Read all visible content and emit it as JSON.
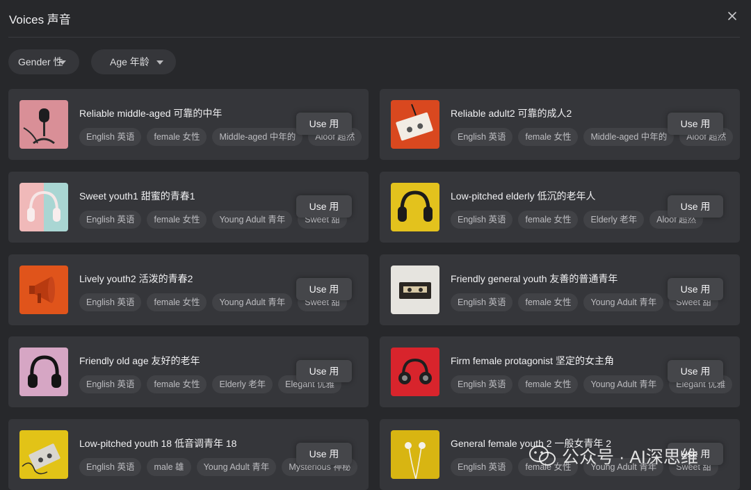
{
  "dialog": {
    "title": "Voices 声音",
    "close_icon": "close-icon"
  },
  "filters": [
    {
      "label": "Gender 性",
      "icon": "chevron-down-icon"
    },
    {
      "label": "Age 年龄",
      "icon": "chevron-down-icon"
    }
  ],
  "voices": [
    {
      "name": "Reliable middle-aged 可靠的中年",
      "tags": [
        "English 英语",
        "female 女性",
        "Middle-aged 中年的",
        "Aloof 超然"
      ],
      "use_label": "Use  用",
      "thumb": "microphone-image"
    },
    {
      "name": "Reliable adult2 可靠的成人2",
      "tags": [
        "English 英语",
        "female 女性",
        "Middle-aged 中年的",
        "Aloof 超然"
      ],
      "use_label": "Use  用",
      "thumb": "cassette-image"
    },
    {
      "name": "Sweet youth1 甜蜜的青春1",
      "tags": [
        "English 英语",
        "female 女性",
        "Young Adult 青年",
        "Sweet 甜"
      ],
      "use_label": "Use  用",
      "thumb": "headphones-image"
    },
    {
      "name": "Low-pitched elderly 低沉的老年人",
      "tags": [
        "English 英语",
        "female 女性",
        "Elderly 老年",
        "Aloof 超然"
      ],
      "use_label": "Use  用",
      "thumb": "headphones-image"
    },
    {
      "name": "Lively youth2 活泼的青春2",
      "tags": [
        "English 英语",
        "female 女性",
        "Young Adult 青年",
        "Sweet 甜"
      ],
      "use_label": "Use  用",
      "thumb": "megaphone-image"
    },
    {
      "name": "Friendly general youth 友善的普通青年",
      "tags": [
        "English 英语",
        "female 女性",
        "Young Adult 青年",
        "Sweet 甜"
      ],
      "use_label": "Use  用",
      "thumb": "cassette-image"
    },
    {
      "name": "Friendly old age 友好的老年",
      "tags": [
        "English 英语",
        "female 女性",
        "Elderly 老年",
        "Elegant 优雅"
      ],
      "use_label": "Use  用",
      "thumb": "headphones-image"
    },
    {
      "name": "Firm female protagonist 坚定的女主角",
      "tags": [
        "English 英语",
        "female 女性",
        "Young Adult 青年",
        "Elegant 优雅"
      ],
      "use_label": "Use  用",
      "thumb": "headphones-image"
    },
    {
      "name": "Low-pitched youth 18 低音调青年 18",
      "tags": [
        "English 英语",
        "male 雄",
        "Young Adult 青年",
        "Mysterious 神秘"
      ],
      "use_label": "Use  用",
      "thumb": "cassette-image"
    },
    {
      "name": "General female youth 2 一般女青年 2",
      "tags": [
        "English 英语",
        "female 女性",
        "Young Adult 青年",
        "Sweet 甜"
      ],
      "use_label": "Use  用",
      "thumb": "earphones-image"
    }
  ],
  "watermark": {
    "text": "公众号 · AI深思维",
    "icon": "wechat-icon"
  },
  "colors": {
    "background": "#27282b",
    "card": "#35363a",
    "tag": "#414246",
    "button": "#45464a"
  }
}
